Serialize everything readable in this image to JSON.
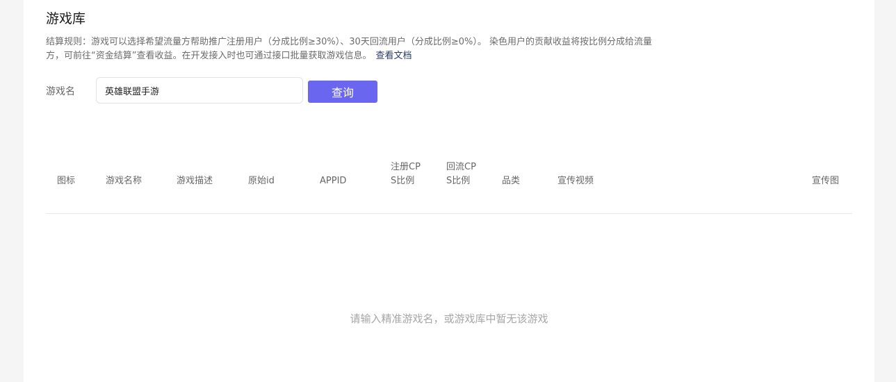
{
  "page": {
    "title": "游戏库",
    "rules_text": "结算规则：游戏可以选择希望流量方帮助推广注册用户（分成比例≥30%）、30天回流用户（分成比例≥0%）。 染色用户的贡献收益将按比例分成给流量方，可前往“资金结算”查看收益。在开发接入时也可通过接口批量获取游戏信息。",
    "rules_link": "查看文档"
  },
  "search": {
    "label": "游戏名",
    "value": "英雄联盟手游",
    "button_label": "查询"
  },
  "table": {
    "columns": {
      "icon": "图标",
      "name": "游戏名称",
      "description": "游戏描述",
      "original_id": "原始id",
      "appid": "APPID",
      "register_cps": "注册CPS比例",
      "return_cps": "回流CPS比例",
      "category": "品类",
      "promo_video": "宣传视频",
      "promo_image": "宣传图"
    },
    "empty_text": "请输入精准游戏名，或游戏库中暂无该游戏"
  }
}
